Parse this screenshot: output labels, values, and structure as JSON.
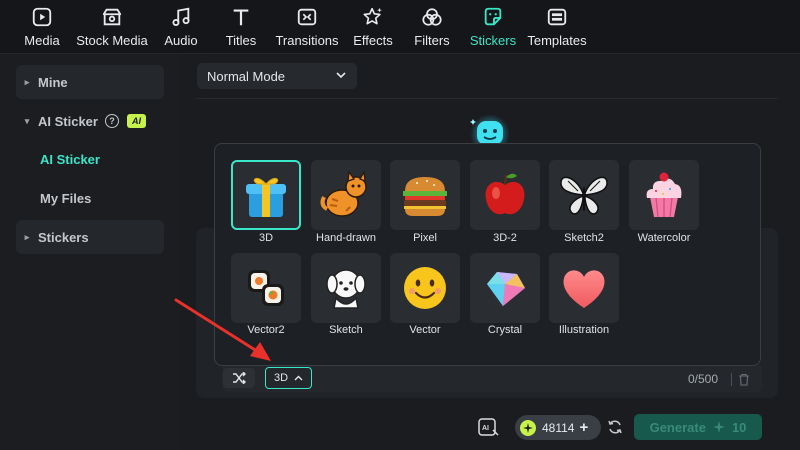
{
  "toolbar": {
    "tabs": [
      {
        "label": "Media",
        "icon": "media-icon"
      },
      {
        "label": "Stock Media",
        "icon": "stock-media-icon"
      },
      {
        "label": "Audio",
        "icon": "music-note-icon"
      },
      {
        "label": "Titles",
        "icon": "text-t-icon"
      },
      {
        "label": "Transitions",
        "icon": "transitions-icon"
      },
      {
        "label": "Effects",
        "icon": "effects-star-icon"
      },
      {
        "label": "Filters",
        "icon": "filters-icon"
      },
      {
        "label": "Stickers",
        "icon": "sticker-icon",
        "active": true
      },
      {
        "label": "Templates",
        "icon": "templates-icon"
      }
    ]
  },
  "sidebar": {
    "mine": "Mine",
    "ai_sticker": "AI Sticker",
    "ai_badge": "AI",
    "sub_ai_sticker": "AI Sticker",
    "sub_my_files": "My Files",
    "stickers": "Stickers"
  },
  "main": {
    "mode": "Normal Mode"
  },
  "styles": [
    {
      "label": "3D",
      "selected": true
    },
    {
      "label": "Hand-drawn"
    },
    {
      "label": "Pixel"
    },
    {
      "label": "3D-2"
    },
    {
      "label": "Sketch2"
    },
    {
      "label": "Watercolor"
    },
    {
      "label": "Vector2"
    },
    {
      "label": "Sketch"
    },
    {
      "label": "Vector"
    },
    {
      "label": "Crystal"
    },
    {
      "label": "Illustration"
    }
  ],
  "input": {
    "style_button": "3D",
    "counter": "0/500"
  },
  "footer": {
    "credits": "48114",
    "generate_label": "Generate",
    "generate_cost": "10"
  },
  "colors": {
    "accent": "#39e6c8",
    "ai_badge": "#c6f24c",
    "annotation": "#e8312a"
  }
}
